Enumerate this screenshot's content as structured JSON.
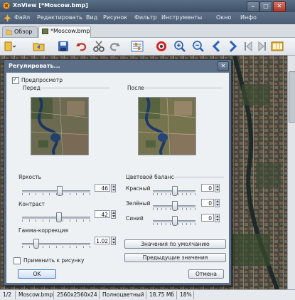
{
  "window": {
    "app_name": "XnView",
    "document": "[*Moscow.bmp]"
  },
  "menu": [
    "Файл",
    "Редактировать",
    "Вид",
    "Рисунок",
    "Фильтр",
    "Инструменты",
    "Окно",
    "Инфо"
  ],
  "tabs": [
    {
      "label": "Обзор"
    },
    {
      "label": "*Moscow.bmp"
    }
  ],
  "toolbar_icons": [
    "open-dropdown-icon",
    "browse-icon",
    "save-icon",
    "undo-icon",
    "cut-icon",
    "redo-icon",
    "adjust-icon",
    "color-balance-icon",
    "zoom-in-icon",
    "zoom-out-icon",
    "previous-icon",
    "next-icon",
    "first-icon",
    "last-icon",
    "filmstrip-icon"
  ],
  "dialog": {
    "title": "Регулировать...",
    "close": "✕",
    "preview_label": "Предпросмотр",
    "preview_checked": true,
    "before_label": "Перед",
    "after_label": "После",
    "brightness": {
      "label": "Яркость",
      "value": "46",
      "level": 0.55
    },
    "contrast": {
      "label": "Контраст",
      "value": "42",
      "level": 0.54
    },
    "gamma": {
      "label": "Гамма-коррекция",
      "value": "1.02",
      "level": 0.18
    },
    "color_balance": {
      "label": "Цветовой баланс",
      "red": {
        "label": "Красный",
        "value": "0",
        "level": 0.5
      },
      "green": {
        "label": "Зелёный",
        "value": "0",
        "level": 0.5
      },
      "blue": {
        "label": "Синий",
        "value": "0",
        "level": 0.5
      }
    },
    "apply_label": "Применить к рисунку",
    "apply_checked": false,
    "defaults_button": "Значения по умолчанию",
    "previous_button": "Предыдущие значения",
    "ok_button": "OK",
    "cancel_button": "Отмена"
  },
  "status": {
    "page": "1/2",
    "file": "Moscow.bmp",
    "dims": "2560x2560x24",
    "color_mode": "Полноцветный",
    "size": "18.75 Мб",
    "zoom": "18%"
  }
}
